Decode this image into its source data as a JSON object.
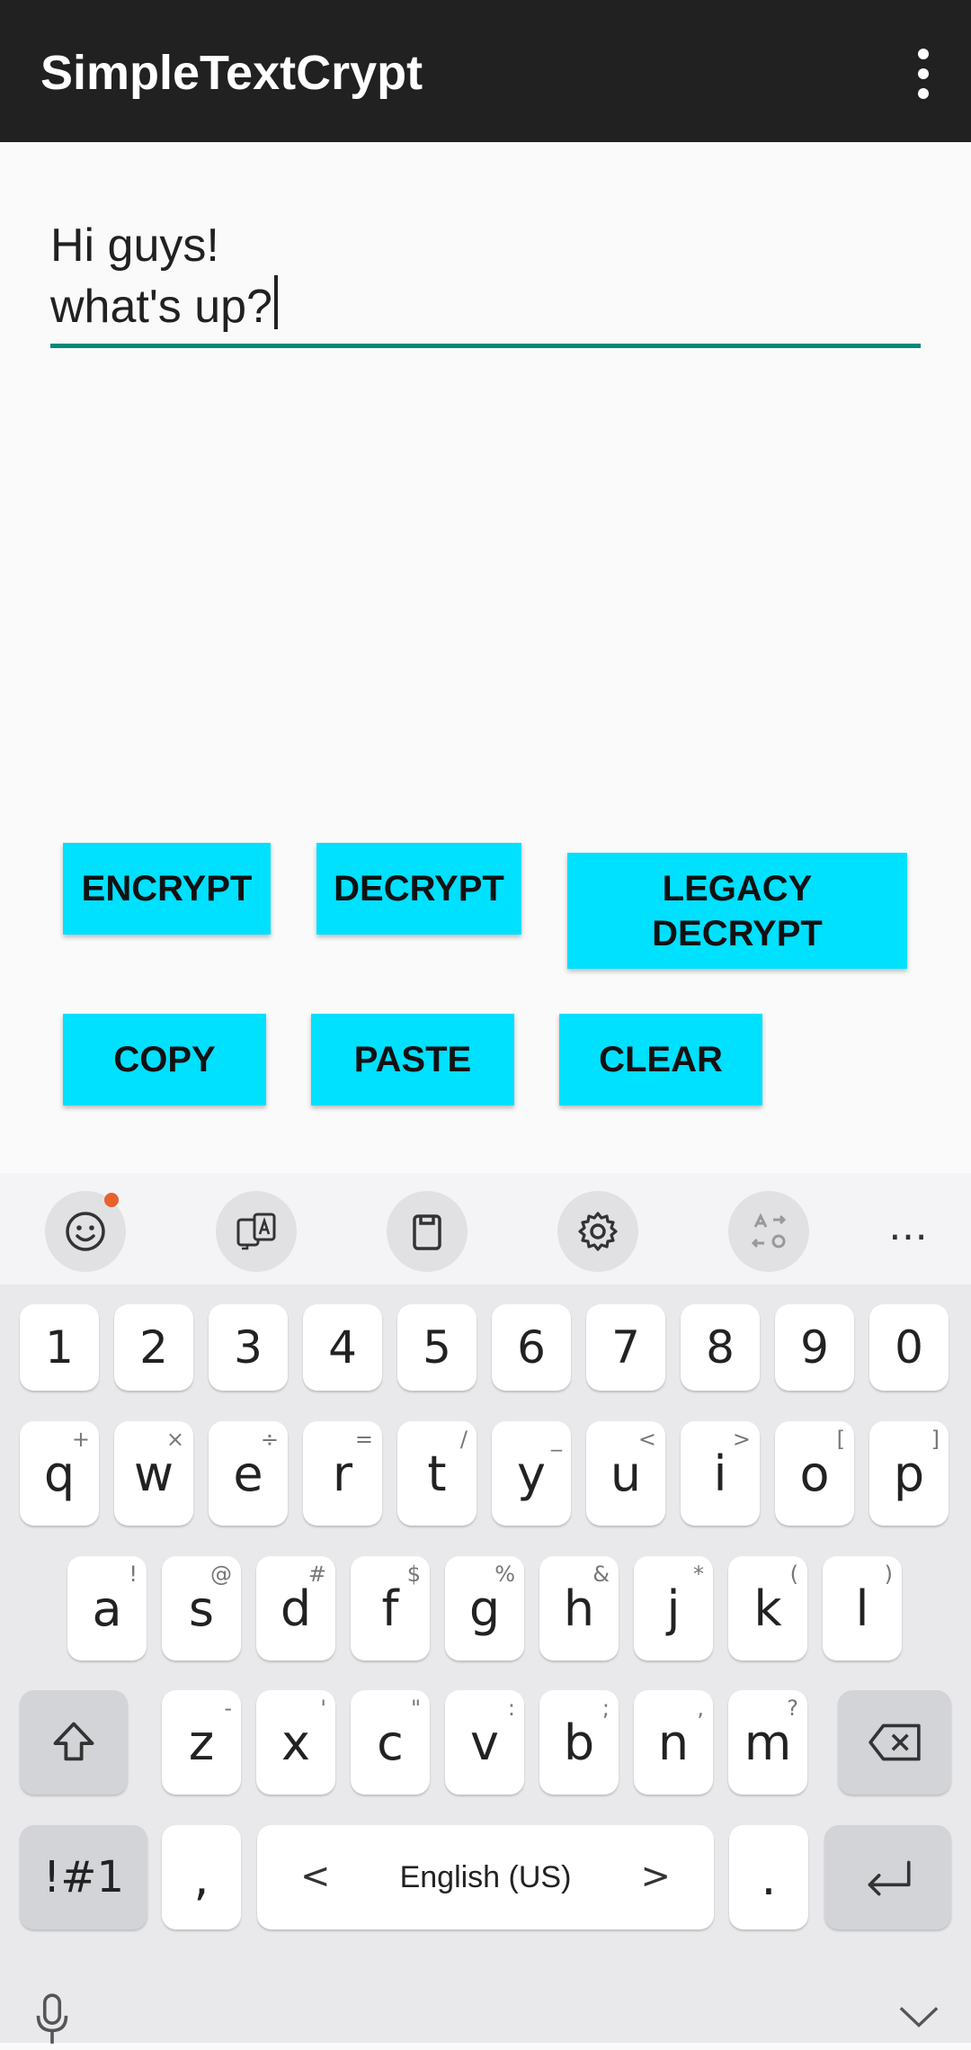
{
  "appbar": {
    "title": "SimpleTextCrypt"
  },
  "editor": {
    "line1": "Hi guys!",
    "line2": "what's up?"
  },
  "buttons": {
    "encrypt": "ENCRYPT",
    "decrypt": "DECRYPT",
    "legacy_line1": "LEGACY",
    "legacy_line2": "DECRYPT",
    "copy": "COPY",
    "paste": "PASTE",
    "clear": "CLEAR"
  },
  "colors": {
    "appbar": "#212121",
    "button": "#00e0ff",
    "accent": "#00897b",
    "badge": "#e8622c"
  },
  "keyboard": {
    "toolbar_more": "…",
    "numbers": [
      "1",
      "2",
      "3",
      "4",
      "5",
      "6",
      "7",
      "8",
      "9",
      "0"
    ],
    "row1": [
      {
        "k": "q",
        "s": "+"
      },
      {
        "k": "w",
        "s": "×"
      },
      {
        "k": "e",
        "s": "÷"
      },
      {
        "k": "r",
        "s": "="
      },
      {
        "k": "t",
        "s": "/"
      },
      {
        "k": "y",
        "s": "_"
      },
      {
        "k": "u",
        "s": "<"
      },
      {
        "k": "i",
        "s": ">"
      },
      {
        "k": "o",
        "s": "["
      },
      {
        "k": "p",
        "s": "]"
      }
    ],
    "row2": [
      {
        "k": "a",
        "s": "!"
      },
      {
        "k": "s",
        "s": "@"
      },
      {
        "k": "d",
        "s": "#"
      },
      {
        "k": "f",
        "s": "$"
      },
      {
        "k": "g",
        "s": "%"
      },
      {
        "k": "h",
        "s": "&"
      },
      {
        "k": "j",
        "s": "*"
      },
      {
        "k": "k",
        "s": "("
      },
      {
        "k": "l",
        "s": ")"
      }
    ],
    "row3": [
      {
        "k": "z",
        "s": "-"
      },
      {
        "k": "x",
        "s": "'"
      },
      {
        "k": "c",
        "s": "\""
      },
      {
        "k": "v",
        "s": ":"
      },
      {
        "k": "b",
        "s": ";"
      },
      {
        "k": "n",
        "s": ","
      },
      {
        "k": "m",
        "s": "?"
      }
    ],
    "symbols_label": "!#1",
    "comma": ",",
    "space_label": "English (US)",
    "left_arrow": "<",
    "right_arrow": ">",
    "period": "."
  }
}
